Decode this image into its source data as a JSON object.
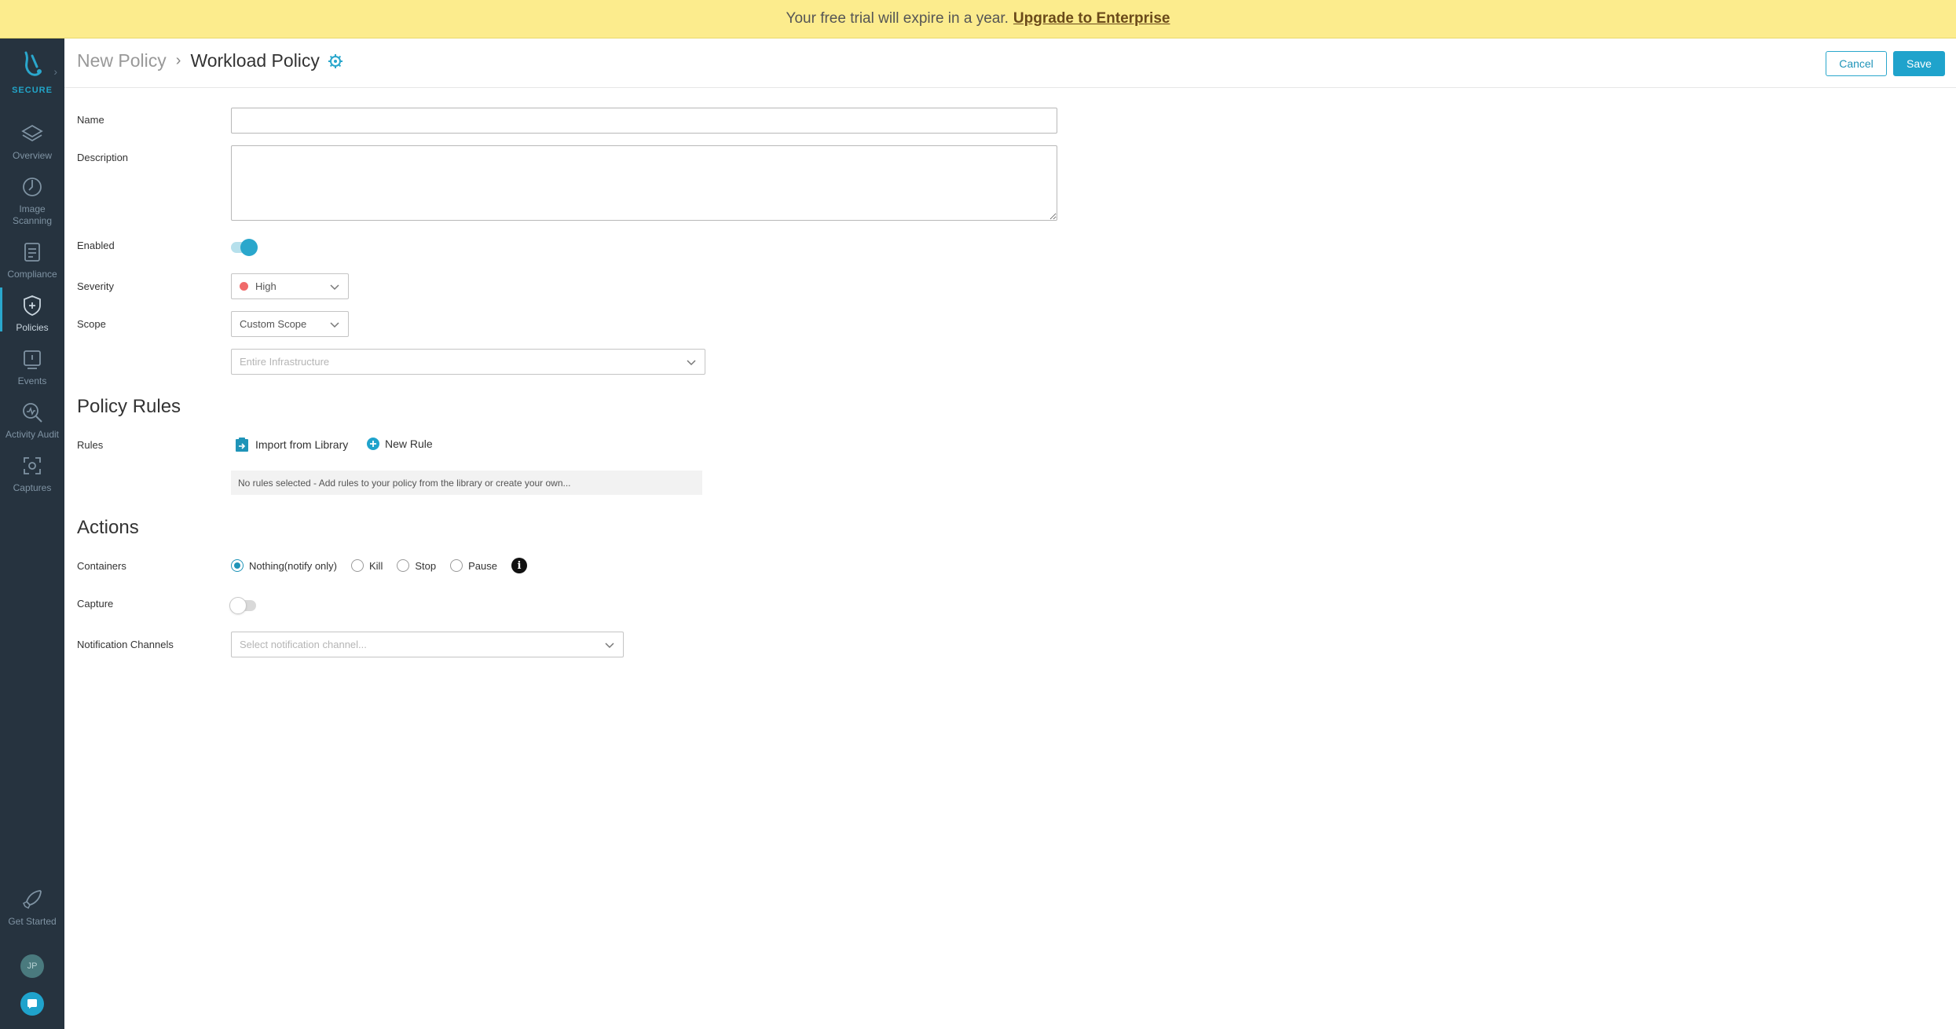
{
  "banner": {
    "text": "Your free trial will expire in a year.",
    "link": "Upgrade to Enterprise"
  },
  "sidebar": {
    "brand": "SECURE",
    "items": [
      {
        "label": "Overview",
        "icon": "layers-icon"
      },
      {
        "label": "Image Scanning",
        "icon": "scan-icon"
      },
      {
        "label": "Compliance",
        "icon": "clipboard-icon"
      },
      {
        "label": "Policies",
        "icon": "shield-icon",
        "active": true
      },
      {
        "label": "Events",
        "icon": "events-icon"
      },
      {
        "label": "Activity Audit",
        "icon": "audit-icon"
      },
      {
        "label": "Captures",
        "icon": "capture-icon"
      }
    ],
    "get_started": "Get Started",
    "avatar_initials": "JP"
  },
  "header": {
    "crumb_parent": "New Policy",
    "crumb_current": "Workload Policy",
    "cancel": "Cancel",
    "save": "Save"
  },
  "form": {
    "name_label": "Name",
    "name_value": "",
    "description_label": "Description",
    "description_value": "",
    "enabled_label": "Enabled",
    "enabled": true,
    "severity_label": "Severity",
    "severity_value": "High",
    "severity_color": "#f06a6a",
    "scope_label": "Scope",
    "scope_value": "Custom Scope",
    "scope_detail_placeholder": "Entire Infrastructure"
  },
  "policy_rules": {
    "title": "Policy Rules",
    "rules_label": "Rules",
    "import_label": "Import from Library",
    "new_rule_label": "New Rule",
    "empty_text": "No rules selected - Add rules to your policy from the library or create your own..."
  },
  "actions": {
    "title": "Actions",
    "containers_label": "Containers",
    "options": [
      "Nothing(notify only)",
      "Kill",
      "Stop",
      "Pause"
    ],
    "selected": "Nothing(notify only)",
    "capture_label": "Capture",
    "capture": false,
    "notification_label": "Notification Channels",
    "notification_placeholder": "Select notification channel..."
  },
  "colors": {
    "accent": "#1fa3cc",
    "sidebar": "#26333f",
    "banner": "#fcec8d"
  }
}
